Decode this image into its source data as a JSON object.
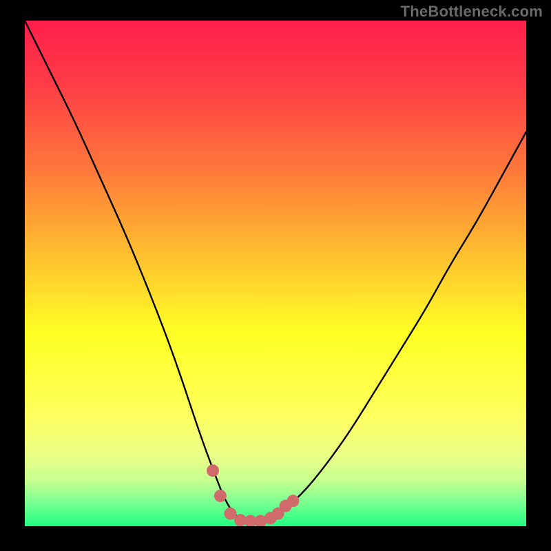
{
  "attribution": "TheBottleneck.com",
  "chart_data": {
    "type": "line",
    "title": "",
    "xlabel": "",
    "ylabel": "",
    "xlim": [
      0,
      100
    ],
    "ylim": [
      0,
      100
    ],
    "grid": false,
    "legend": false,
    "series": [
      {
        "name": "bottleneck-curve",
        "x": [
          0,
          5,
          10,
          15,
          20,
          25,
          30,
          35,
          38,
          40,
          42,
          44,
          46,
          48,
          50,
          55,
          60,
          65,
          70,
          75,
          80,
          85,
          90,
          95,
          100
        ],
        "values": [
          100,
          90,
          80,
          69,
          58,
          46,
          33,
          18,
          10,
          5,
          2,
          1,
          1,
          1,
          2,
          6,
          12,
          19,
          27,
          35,
          43,
          52,
          60,
          69,
          78
        ]
      }
    ],
    "markers": {
      "name": "highlight-dots",
      "color": "#d16b6b",
      "points": [
        {
          "x": 37.5,
          "y": 11
        },
        {
          "x": 39.0,
          "y": 6
        },
        {
          "x": 41.0,
          "y": 2.5
        },
        {
          "x": 43.0,
          "y": 1.2
        },
        {
          "x": 45.0,
          "y": 1.0
        },
        {
          "x": 47.0,
          "y": 1.0
        },
        {
          "x": 49.0,
          "y": 1.6
        },
        {
          "x": 50.5,
          "y": 2.5
        },
        {
          "x": 52.0,
          "y": 4.0
        },
        {
          "x": 53.5,
          "y": 5.0
        }
      ]
    },
    "gradient_stops": [
      {
        "offset": 0,
        "color": "#ff1f4b"
      },
      {
        "offset": 12,
        "color": "#ff3a47"
      },
      {
        "offset": 30,
        "color": "#ff7a3a"
      },
      {
        "offset": 50,
        "color": "#ffcf2d"
      },
      {
        "offset": 62,
        "color": "#ffff24"
      },
      {
        "offset": 78,
        "color": "#ffff5e"
      },
      {
        "offset": 86,
        "color": "#eaff87"
      },
      {
        "offset": 91,
        "color": "#c6ff8f"
      },
      {
        "offset": 95,
        "color": "#7fff91"
      },
      {
        "offset": 100,
        "color": "#1fff80"
      }
    ]
  }
}
